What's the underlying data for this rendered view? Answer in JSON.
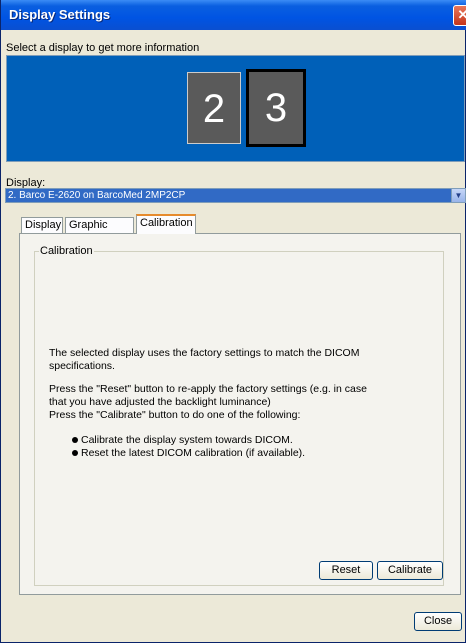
{
  "window": {
    "title": "Display Settings",
    "close_glyph": "✕"
  },
  "selector": {
    "prompt": "Select a display to get more information",
    "monitors": [
      "2",
      "3"
    ],
    "selected_monitor": "3"
  },
  "display_field": {
    "label": "Display:",
    "value": "2. Barco E-2620 on BarcoMed 2MP2CP",
    "dropdown_icon": "chevron-down-icon"
  },
  "tabs": [
    {
      "label": "Display"
    },
    {
      "label": "Graphic Board"
    },
    {
      "label": "Calibration"
    }
  ],
  "calibration": {
    "group_title": "Calibration",
    "para1_line1": "The selected display uses the factory settings to match the DICOM",
    "para1_line2": "specifications.",
    "para2_line1": "Press the \"Reset\" button to re-apply the factory settings (e.g. in case",
    "para2_line2": "that you have adjusted the backlight luminance)",
    "para2_line3": "Press the \"Calibrate\" button to do one of the following:",
    "bullets": [
      "Calibrate the display system towards DICOM.",
      "Reset the latest DICOM calibration (if available)."
    ],
    "reset_label": "Reset",
    "calibrate_label": "Calibrate"
  },
  "footer": {
    "close_label": "Close"
  },
  "colors": {
    "titlebar": "#0054e3",
    "display_panel": "#0060b8",
    "combo_selected": "#316ac5",
    "active_tab_accent": "#e68b2c"
  }
}
